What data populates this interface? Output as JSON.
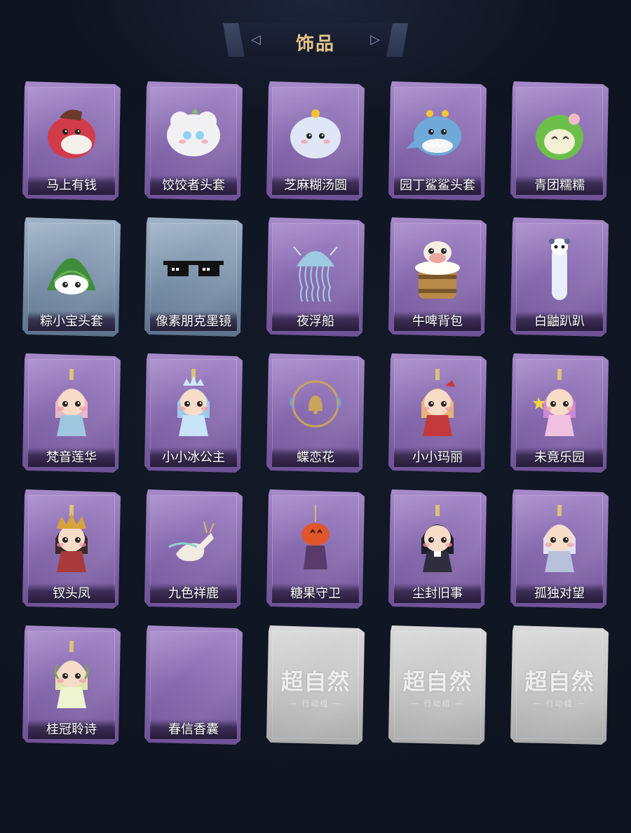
{
  "header": {
    "title": "饰品"
  },
  "watermark": {
    "main": "超自然",
    "sub": "— 行动组 —"
  },
  "items": [
    {
      "name": "马上有钱",
      "style": "purple",
      "icon": "red-horse-hat-icon",
      "accent": "#d23b4a"
    },
    {
      "name": "饺饺者头套",
      "style": "purple",
      "icon": "dumpling-hat-icon",
      "accent": "#f1f1f4"
    },
    {
      "name": "芝麻糊汤圆",
      "style": "purple",
      "icon": "rice-ball-icon",
      "accent": "#dfe6f5"
    },
    {
      "name": "园丁鲨鲨头套",
      "style": "purple",
      "icon": "shark-hat-icon",
      "accent": "#6fa9d8"
    },
    {
      "name": "青团糯糯",
      "style": "purple",
      "icon": "green-rice-ball-icon",
      "accent": "#6cc04a"
    },
    {
      "name": "粽小宝头套",
      "style": "blue",
      "icon": "zongzi-hat-icon",
      "accent": "#3f8d3a"
    },
    {
      "name": "像素朋克墨镜",
      "style": "blue",
      "icon": "pixel-sunglasses-icon",
      "accent": "#111111"
    },
    {
      "name": "夜浮船",
      "style": "purple",
      "icon": "jellyfish-icon",
      "accent": "#9fd3e8"
    },
    {
      "name": "牛啤背包",
      "style": "purple",
      "icon": "cow-beer-backpack-icon",
      "accent": "#b88a4a"
    },
    {
      "name": "白鼬趴趴",
      "style": "purple",
      "icon": "white-ferret-icon",
      "accent": "#e8eefa"
    },
    {
      "name": "梵音莲华",
      "style": "purple",
      "icon": "lotus-doll-icon",
      "accent": "#f0c9c0"
    },
    {
      "name": "小小冰公主",
      "style": "purple",
      "icon": "ice-princess-doll-icon",
      "accent": "#8fc0ea"
    },
    {
      "name": "蝶恋花",
      "style": "purple",
      "icon": "bell-charm-icon",
      "accent": "#c9a45a"
    },
    {
      "name": "小小玛丽",
      "style": "purple",
      "icon": "mary-doll-icon",
      "accent": "#c43a3a"
    },
    {
      "name": "未竟乐园",
      "style": "purple",
      "icon": "paradise-doll-icon",
      "accent": "#d48bc9"
    },
    {
      "name": "钗头凤",
      "style": "purple",
      "icon": "phoenix-crown-doll-icon",
      "accent": "#d8a23a"
    },
    {
      "name": "九色祥鹿",
      "style": "purple",
      "icon": "deer-charm-icon",
      "accent": "#f0ece2"
    },
    {
      "name": "糖果守卫",
      "style": "purple",
      "icon": "pumpkin-charm-icon",
      "accent": "#e0562a"
    },
    {
      "name": "尘封旧事",
      "style": "purple",
      "icon": "gentleman-doll-icon",
      "accent": "#2a2a3a"
    },
    {
      "name": "孤独对望",
      "style": "purple",
      "icon": "silver-doll-icon",
      "accent": "#d6d6ea"
    },
    {
      "name": "桂冠聆诗",
      "style": "purple",
      "icon": "laurel-doll-icon",
      "accent": "#cfe0a0"
    },
    {
      "name": "春信香囊",
      "style": "purple",
      "icon": "empty-slot-icon",
      "accent": "#b69cd6"
    },
    {
      "name": "",
      "style": "gray",
      "icon": "locked-placeholder-icon",
      "accent": "#cccccc"
    },
    {
      "name": "",
      "style": "gray",
      "icon": "locked-placeholder-icon",
      "accent": "#cccccc"
    },
    {
      "name": "",
      "style": "gray",
      "icon": "locked-placeholder-icon",
      "accent": "#cccccc"
    }
  ]
}
